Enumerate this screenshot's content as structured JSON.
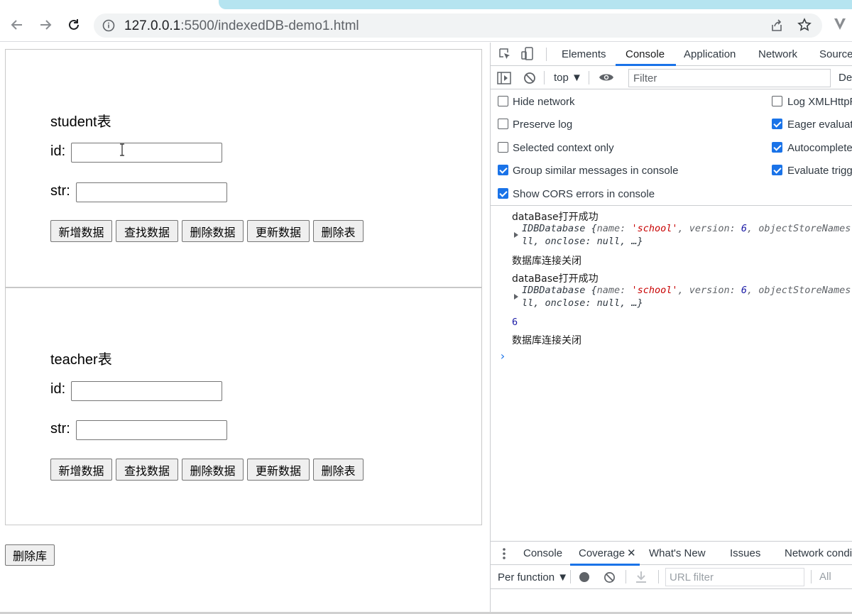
{
  "browser": {
    "url_host": "127.0.0.1",
    "url_rest": ":5500/indexedDB-demo1.html"
  },
  "page": {
    "student": {
      "title": "student表",
      "id_label": "id:",
      "str_label": "str:",
      "buttons": [
        "新增数据",
        "查找数据",
        "删除数据",
        "更新数据",
        "删除表"
      ]
    },
    "teacher": {
      "title": "teacher表",
      "id_label": "id:",
      "str_label": "str:",
      "buttons": [
        "新增数据",
        "查找数据",
        "删除数据",
        "更新数据",
        "删除表"
      ]
    },
    "delete_db_label": "删除库"
  },
  "devtools": {
    "tabs": [
      "Elements",
      "Console",
      "Application",
      "Network",
      "Source"
    ],
    "active_tab": "Console",
    "context": "top",
    "filter_placeholder": "Filter",
    "default_levels": "Def",
    "settings_left": [
      {
        "label": "Hide network",
        "checked": false
      },
      {
        "label": "Preserve log",
        "checked": false
      },
      {
        "label": "Selected context only",
        "checked": false
      },
      {
        "label": "Group similar messages in console",
        "checked": true
      },
      {
        "label": "Show CORS errors in console",
        "checked": true
      }
    ],
    "settings_right": [
      {
        "label": "Log XMLHttpR",
        "checked": false
      },
      {
        "label": "Eager evaluati",
        "checked": true
      },
      {
        "label": "Autocomplete",
        "checked": true
      },
      {
        "label": "Evaluate trigg",
        "checked": true
      }
    ],
    "log": {
      "open1": "dataBase打开成功",
      "obj1_line1_prefix": "IDBDatabase {",
      "obj1_line1_k1": "name: ",
      "obj1_line1_s1": "'school'",
      "obj1_line1_k2": ", version: ",
      "obj1_line1_n1": "6",
      "obj1_line1_k3": ", objectStoreNames",
      "obj1_line2": "ll, onclose: null, …}",
      "close1": "数据库连接关闭",
      "open2": "dataBase打开成功",
      "obj2_line1_prefix": "IDBDatabase {",
      "obj2_line1_k1": "name: ",
      "obj2_line1_s1": "'school'",
      "obj2_line1_k2": ", version: ",
      "obj2_line1_n1": "6",
      "obj2_line1_k3": ", objectStoreNames",
      "obj2_line2": "ll, onclose: null, …}",
      "number": "6",
      "close2": "数据库连接关闭",
      "prompt": "›"
    },
    "drawer_tabs": [
      "Console",
      "Coverage",
      "What's New",
      "Issues",
      "Network condi"
    ],
    "drawer_active": "Coverage",
    "coverage": {
      "type_select": "Per function",
      "url_filter_placeholder": "URL filter",
      "all": "All"
    }
  }
}
